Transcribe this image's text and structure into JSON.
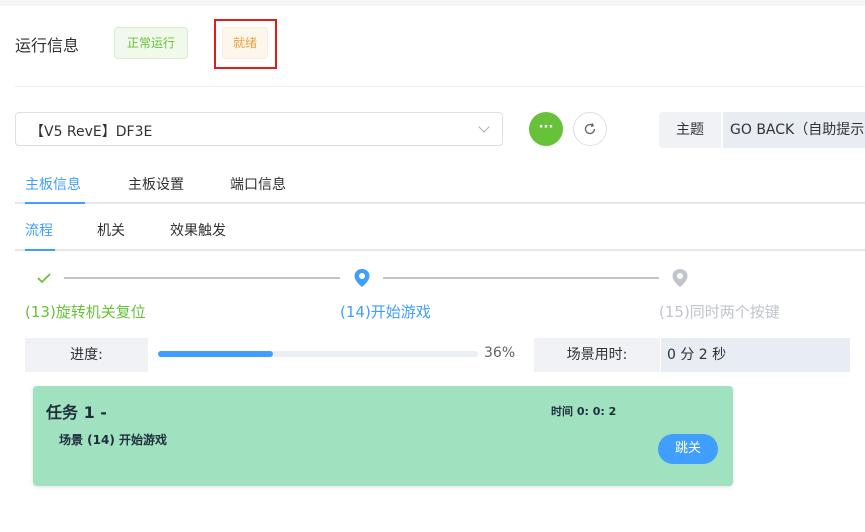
{
  "status": {
    "title": "运行信息",
    "running_tag": "正常运行",
    "ready_tag": "就绪"
  },
  "toolbar": {
    "board_select_value": "【V5 RevE】DF3E",
    "more_icon": "ellipsis-icon",
    "refresh_icon": "refresh-icon",
    "theme_label": "主题",
    "theme_value": "GO BACK（自助提示"
  },
  "main_tabs": [
    {
      "label": "主板信息",
      "active": true
    },
    {
      "label": "主板设置",
      "active": false
    },
    {
      "label": "端口信息",
      "active": false
    }
  ],
  "sub_tabs": [
    {
      "label": "流程",
      "active": true
    },
    {
      "label": "机关",
      "active": false
    },
    {
      "label": "效果触发",
      "active": false
    }
  ],
  "steps": [
    {
      "title": "(13)旋转机关复位",
      "status": "done"
    },
    {
      "title": "(14)开始游戏",
      "status": "active"
    },
    {
      "title": "(15)同时两个按键",
      "status": "wait"
    }
  ],
  "progress": {
    "label": "进度:",
    "value": 0.36,
    "text": "36%"
  },
  "scene_time": {
    "label": "场景用时:",
    "value": "0 分 2 秒"
  },
  "task": {
    "title": "任务 1 -",
    "time": "时间 0: 0: 2",
    "scene": "场景 (14) 开始游戏",
    "skip_label": "跳关"
  },
  "colors": {
    "primary": "#409eff",
    "success": "#67c23a",
    "warning": "#e6a23c",
    "highlight_frame": "#e21b1b",
    "task_card": "#a0e2c0"
  }
}
